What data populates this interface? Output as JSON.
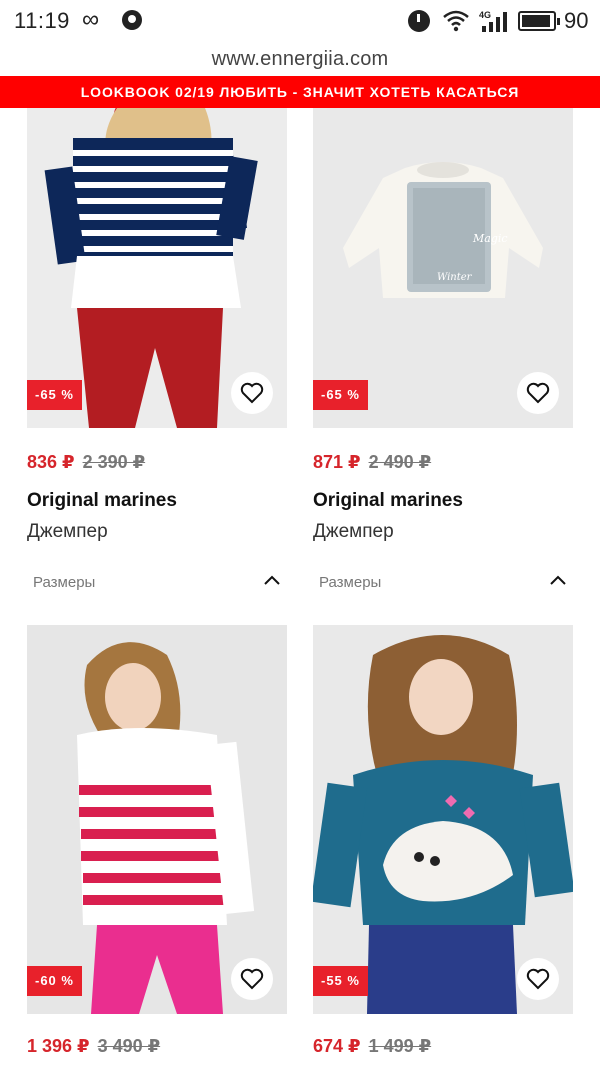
{
  "status_bar": {
    "time": "11:19",
    "battery_level": "90",
    "network": "4G",
    "icons": [
      "infinity-icon",
      "viber-icon",
      "alarm-icon",
      "wifi-icon",
      "signal-icon",
      "battery-icon"
    ]
  },
  "browser": {
    "url": "www.ennergiia.com"
  },
  "promo": {
    "text": "LOOKBOOK 02/19 ЛЮБИТЬ - ЗНАЧИТ ХОТЕТЬ КАСАТЬСЯ",
    "bg_color": "#ff0000"
  },
  "labels": {
    "sizes": "Размеры"
  },
  "colors": {
    "price_red": "#d6252b",
    "badge_red": "#e8212b"
  },
  "products": [
    {
      "discount": "-65 %",
      "price": "836 ₽",
      "old_price": "2 390 ₽",
      "brand": "Original marines",
      "type": "Джемпер",
      "image": "girl-striped-navy-sweater-red-pants"
    },
    {
      "discount": "-65 %",
      "price": "871 ₽",
      "old_price": "2 490 ₽",
      "brand": "Original marines",
      "type": "Джемпер",
      "image": "white-longsleeve-sequin-print"
    },
    {
      "discount": "-60 %",
      "price": "1 396 ₽",
      "old_price": "3 490 ₽",
      "image": "girl-red-white-striped-sweater"
    },
    {
      "discount": "-55 %",
      "price": "674 ₽",
      "old_price": "1 499 ₽",
      "image": "girl-blue-fluffy-whale-sweater"
    }
  ]
}
